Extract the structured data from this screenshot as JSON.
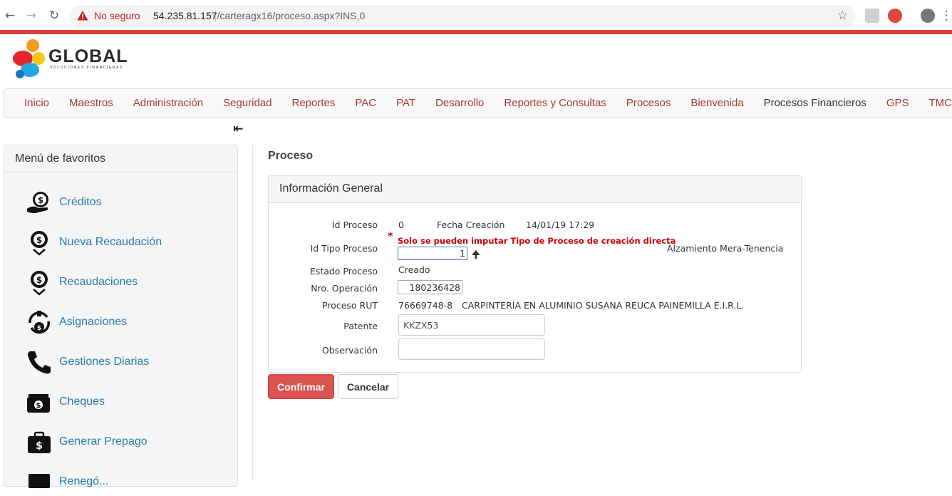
{
  "browser": {
    "security_label": "No seguro",
    "url_host": "54.235.81.157",
    "url_path": "/carteragx16/proceso.aspx?INS,0"
  },
  "logo": {
    "brand": "GLOBAL",
    "tagline": "Soluciones Financieras"
  },
  "menu": {
    "items": [
      {
        "label": "Inicio"
      },
      {
        "label": "Maestros"
      },
      {
        "label": "Administración"
      },
      {
        "label": "Seguridad"
      },
      {
        "label": "Reportes"
      },
      {
        "label": "PAC"
      },
      {
        "label": "PAT"
      },
      {
        "label": "Desarrollo"
      },
      {
        "label": "Reportes y Consultas"
      },
      {
        "label": "Procesos"
      },
      {
        "label": "Bienvenida"
      },
      {
        "label": "Procesos Financieros"
      },
      {
        "label": "GPS"
      },
      {
        "label": "TMC"
      }
    ]
  },
  "sidebar": {
    "title": "Menú de favoritos",
    "items": [
      {
        "label": "Créditos",
        "icon": "credit-icon"
      },
      {
        "label": "Nueva Recaudación",
        "icon": "new-collection-icon"
      },
      {
        "label": "Recaudaciones",
        "icon": "collections-icon"
      },
      {
        "label": "Asignaciones",
        "icon": "assignments-icon"
      },
      {
        "label": "Gestiones Diarias",
        "icon": "phone-icon"
      },
      {
        "label": "Cheques",
        "icon": "wallet-icon"
      },
      {
        "label": "Generar Prepago",
        "icon": "briefcase-icon"
      },
      {
        "label": "Renegó...",
        "icon": "cards-icon"
      }
    ]
  },
  "page": {
    "title": "Proceso"
  },
  "panel": {
    "title": "Información General",
    "id_proceso_label": "Id Proceso",
    "id_proceso_value": "0",
    "fecha_label": "Fecha Creación",
    "fecha_value": "14/01/19 17:29",
    "warning": "Solo se pueden imputar Tipo de Proceso de creación directa",
    "required_mark": "*",
    "tipo_label": "Id Tipo Proceso",
    "tipo_value": "1",
    "tipo_desc": "Alzamiento Mera-Tenencia",
    "estado_label": "Estado Proceso",
    "estado_value": "Creado",
    "operacion_label": "Nro. Operación",
    "operacion_value": "180236428",
    "rut_label": "Proceso RUT",
    "rut_value": "76669748-8",
    "rut_name": "CARPINTERÍA EN ALUMINIO SUSANA REUCA PAINEMILLA E.I.R.L.",
    "patente_label": "Patente",
    "patente_value": "KKZX53",
    "observacion_label": "Observación",
    "observacion_value": ""
  },
  "actions": {
    "confirm": "Confirmar",
    "cancel": "Cancelar"
  }
}
